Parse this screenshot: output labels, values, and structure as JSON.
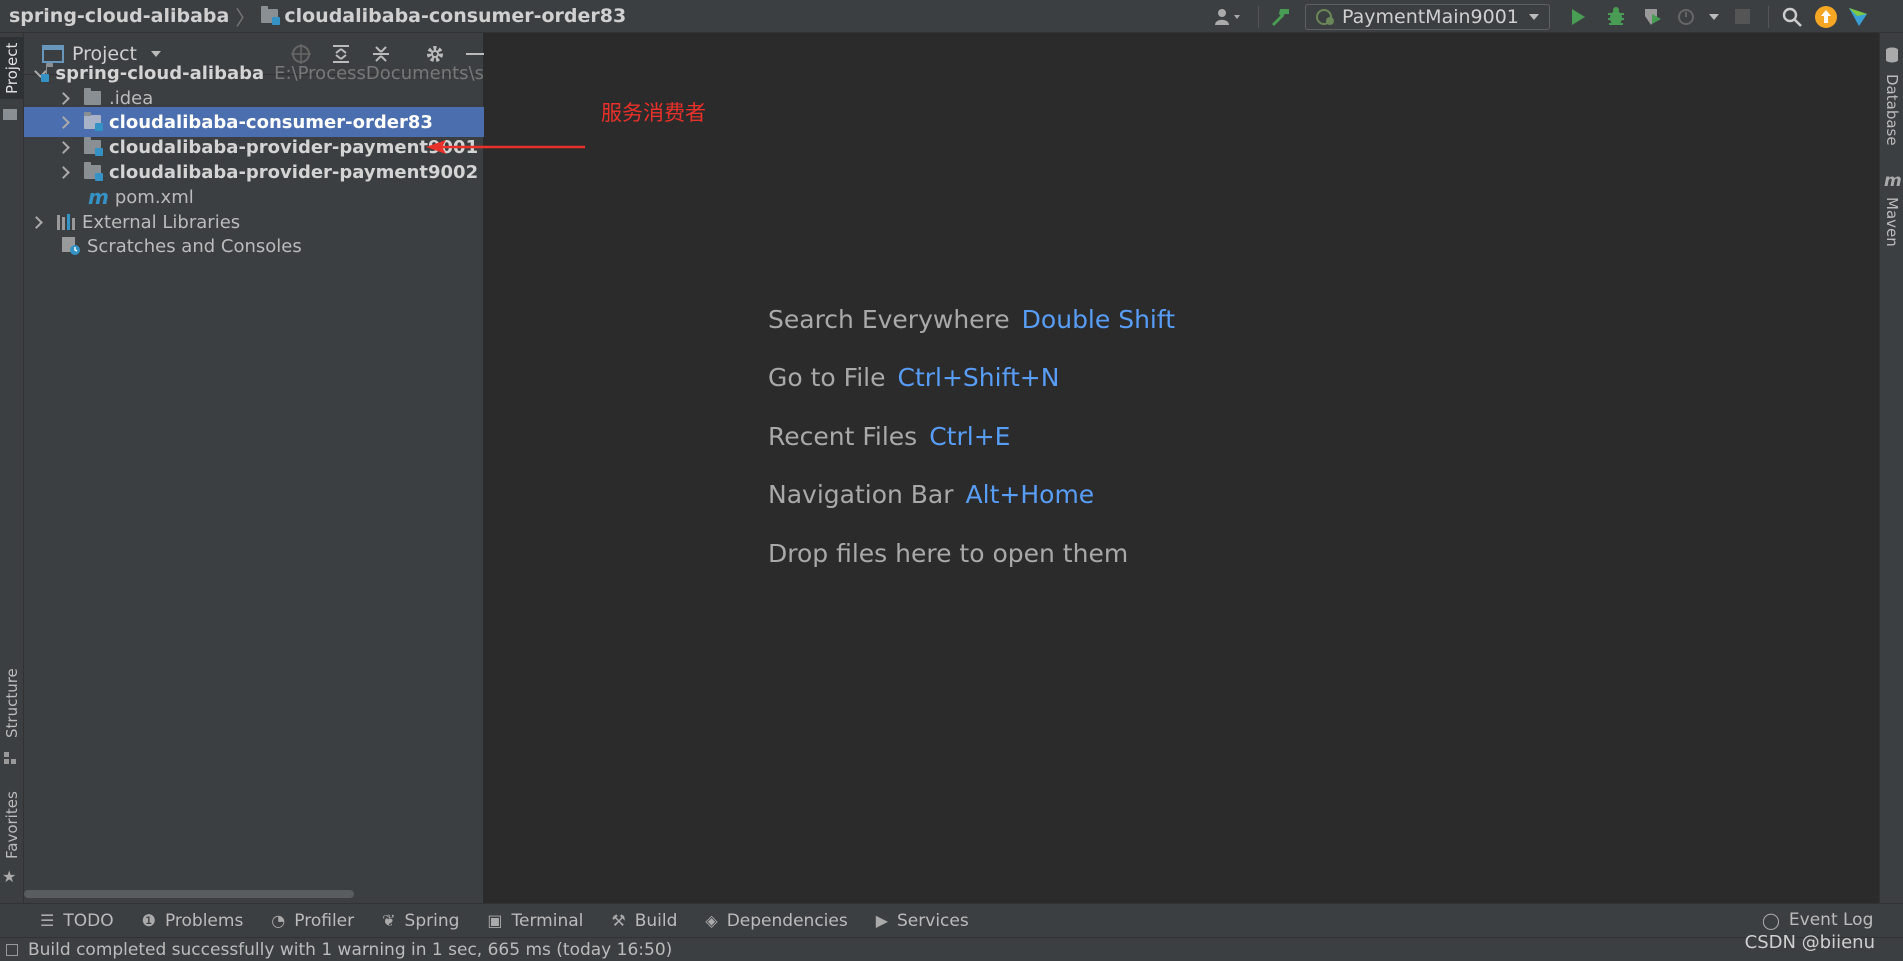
{
  "navbar": {
    "project_name": "spring-cloud-alibaba",
    "module_name": "cloudalibaba-consumer-order83",
    "run_config": "PaymentMain9001"
  },
  "colors": {
    "selection": "#4b6eaf",
    "shortcut": "#589df6",
    "annotation": "#e8312a",
    "run_green": "#499c54",
    "update_orange": "#f5a623"
  },
  "project_panel": {
    "title": "Project",
    "tree": [
      {
        "label": "spring-cloud-alibaba",
        "path": "E:\\ProcessDocuments\\s",
        "expanded": true
      },
      {
        "label": ".idea"
      },
      {
        "label": "cloudalibaba-consumer-order83",
        "selected": true
      },
      {
        "label": "cloudalibaba-provider-payment9001"
      },
      {
        "label": "cloudalibaba-provider-payment9002"
      },
      {
        "label": "pom.xml"
      },
      {
        "label": "External Libraries"
      },
      {
        "label": "Scratches and Consoles"
      }
    ]
  },
  "left_stripe": {
    "project": "Project",
    "structure": "Structure",
    "favorites": "Favorites"
  },
  "right_stripe": {
    "database": "Database",
    "maven": "Maven"
  },
  "editor_hints": [
    {
      "action": "Search Everywhere",
      "shortcut": "Double Shift"
    },
    {
      "action": "Go to File",
      "shortcut": "Ctrl+Shift+N"
    },
    {
      "action": "Recent Files",
      "shortcut": "Ctrl+E"
    },
    {
      "action": "Navigation Bar",
      "shortcut": "Alt+Home"
    },
    {
      "action": "Drop files here to open them",
      "shortcut": ""
    }
  ],
  "annotation": {
    "text": "服务消费者"
  },
  "bottom_tabs": [
    {
      "label": "TODO",
      "icon": "list-icon"
    },
    {
      "label": "Problems",
      "icon": "warning-icon"
    },
    {
      "label": "Profiler",
      "icon": "profiler-icon"
    },
    {
      "label": "Spring",
      "icon": "spring-icon"
    },
    {
      "label": "Terminal",
      "icon": "terminal-icon"
    },
    {
      "label": "Build",
      "icon": "hammer-icon"
    },
    {
      "label": "Dependencies",
      "icon": "dependencies-icon"
    },
    {
      "label": "Services",
      "icon": "services-icon"
    }
  ],
  "event_log": "Event Log",
  "status_text": "Build completed successfully with 1 warning in 1 sec, 665 ms (today 16:50)",
  "watermark": "CSDN @biienu"
}
